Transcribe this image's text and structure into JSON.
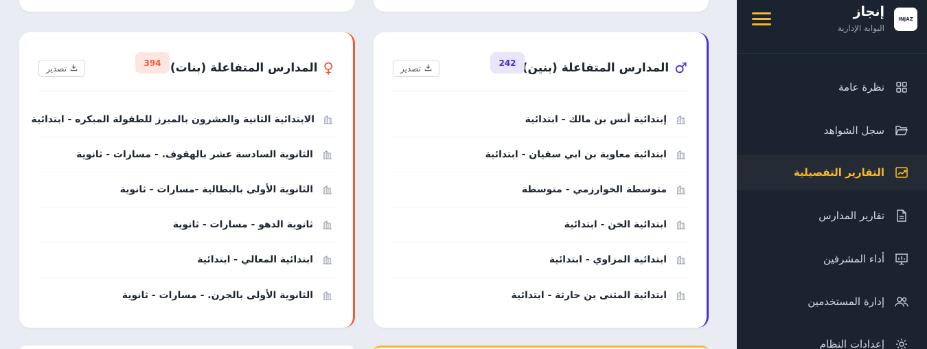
{
  "sidebar": {
    "brand_title": "إنجاز",
    "brand_subtitle": "البوابة الإدارية",
    "logo_text": "INJAZ",
    "accent_color": "#f5b72b",
    "items": [
      {
        "label": "نظرة عامة",
        "icon": "grid-icon"
      },
      {
        "label": "سجل الشواهد",
        "icon": "folder-icon"
      },
      {
        "label": "التقارير التفصيلية",
        "icon": "chart-icon",
        "active": true
      },
      {
        "label": "تقارير المدارس",
        "icon": "document-icon"
      },
      {
        "label": "أداء المشرفين",
        "icon": "presentation-icon"
      },
      {
        "label": "إدارة المستخدمين",
        "icon": "users-icon"
      },
      {
        "label": "إعدادات النظام",
        "icon": "gear-icon"
      }
    ]
  },
  "boys_card": {
    "title": "المدارس المتفاعلة (بنين)",
    "count": "242",
    "accent_color": "#4a2fd8",
    "export_label": "تصدير",
    "schools": [
      "إبتدائية أنس بن مالك - ابتدائية",
      "ابتدائية معاوية بن ابي سفيان - ابتدائية",
      "متوسطة الخوارزمي - متوسطة",
      "ابتدائية الخن - ابتدائية",
      "ابتدائية المزاوي - ابتدائية",
      "ابتدائية المثنى بن حارثة - ابتدائية"
    ]
  },
  "girls_card": {
    "title": "المدارس المتفاعلة (بنات)",
    "count": "394",
    "accent_color": "#ef5a3c",
    "export_label": "تصدير",
    "schools": [
      "الابتدائية الثانية والعشرون بالمبرز للطفولة المبكره - ابتدائية",
      "الثانوية السادسة عشر بالهفوف. - مسارات - ثانوية",
      "الثانوية الأولى بالبطالية -مسارات - ثانوية",
      "ثانوية الدهو - مسارات - ثانوية",
      "ابتدائية المعالي - ابتدائية",
      "الثانوية الأولى بالجرن. - مسارات - ثانوية"
    ]
  }
}
